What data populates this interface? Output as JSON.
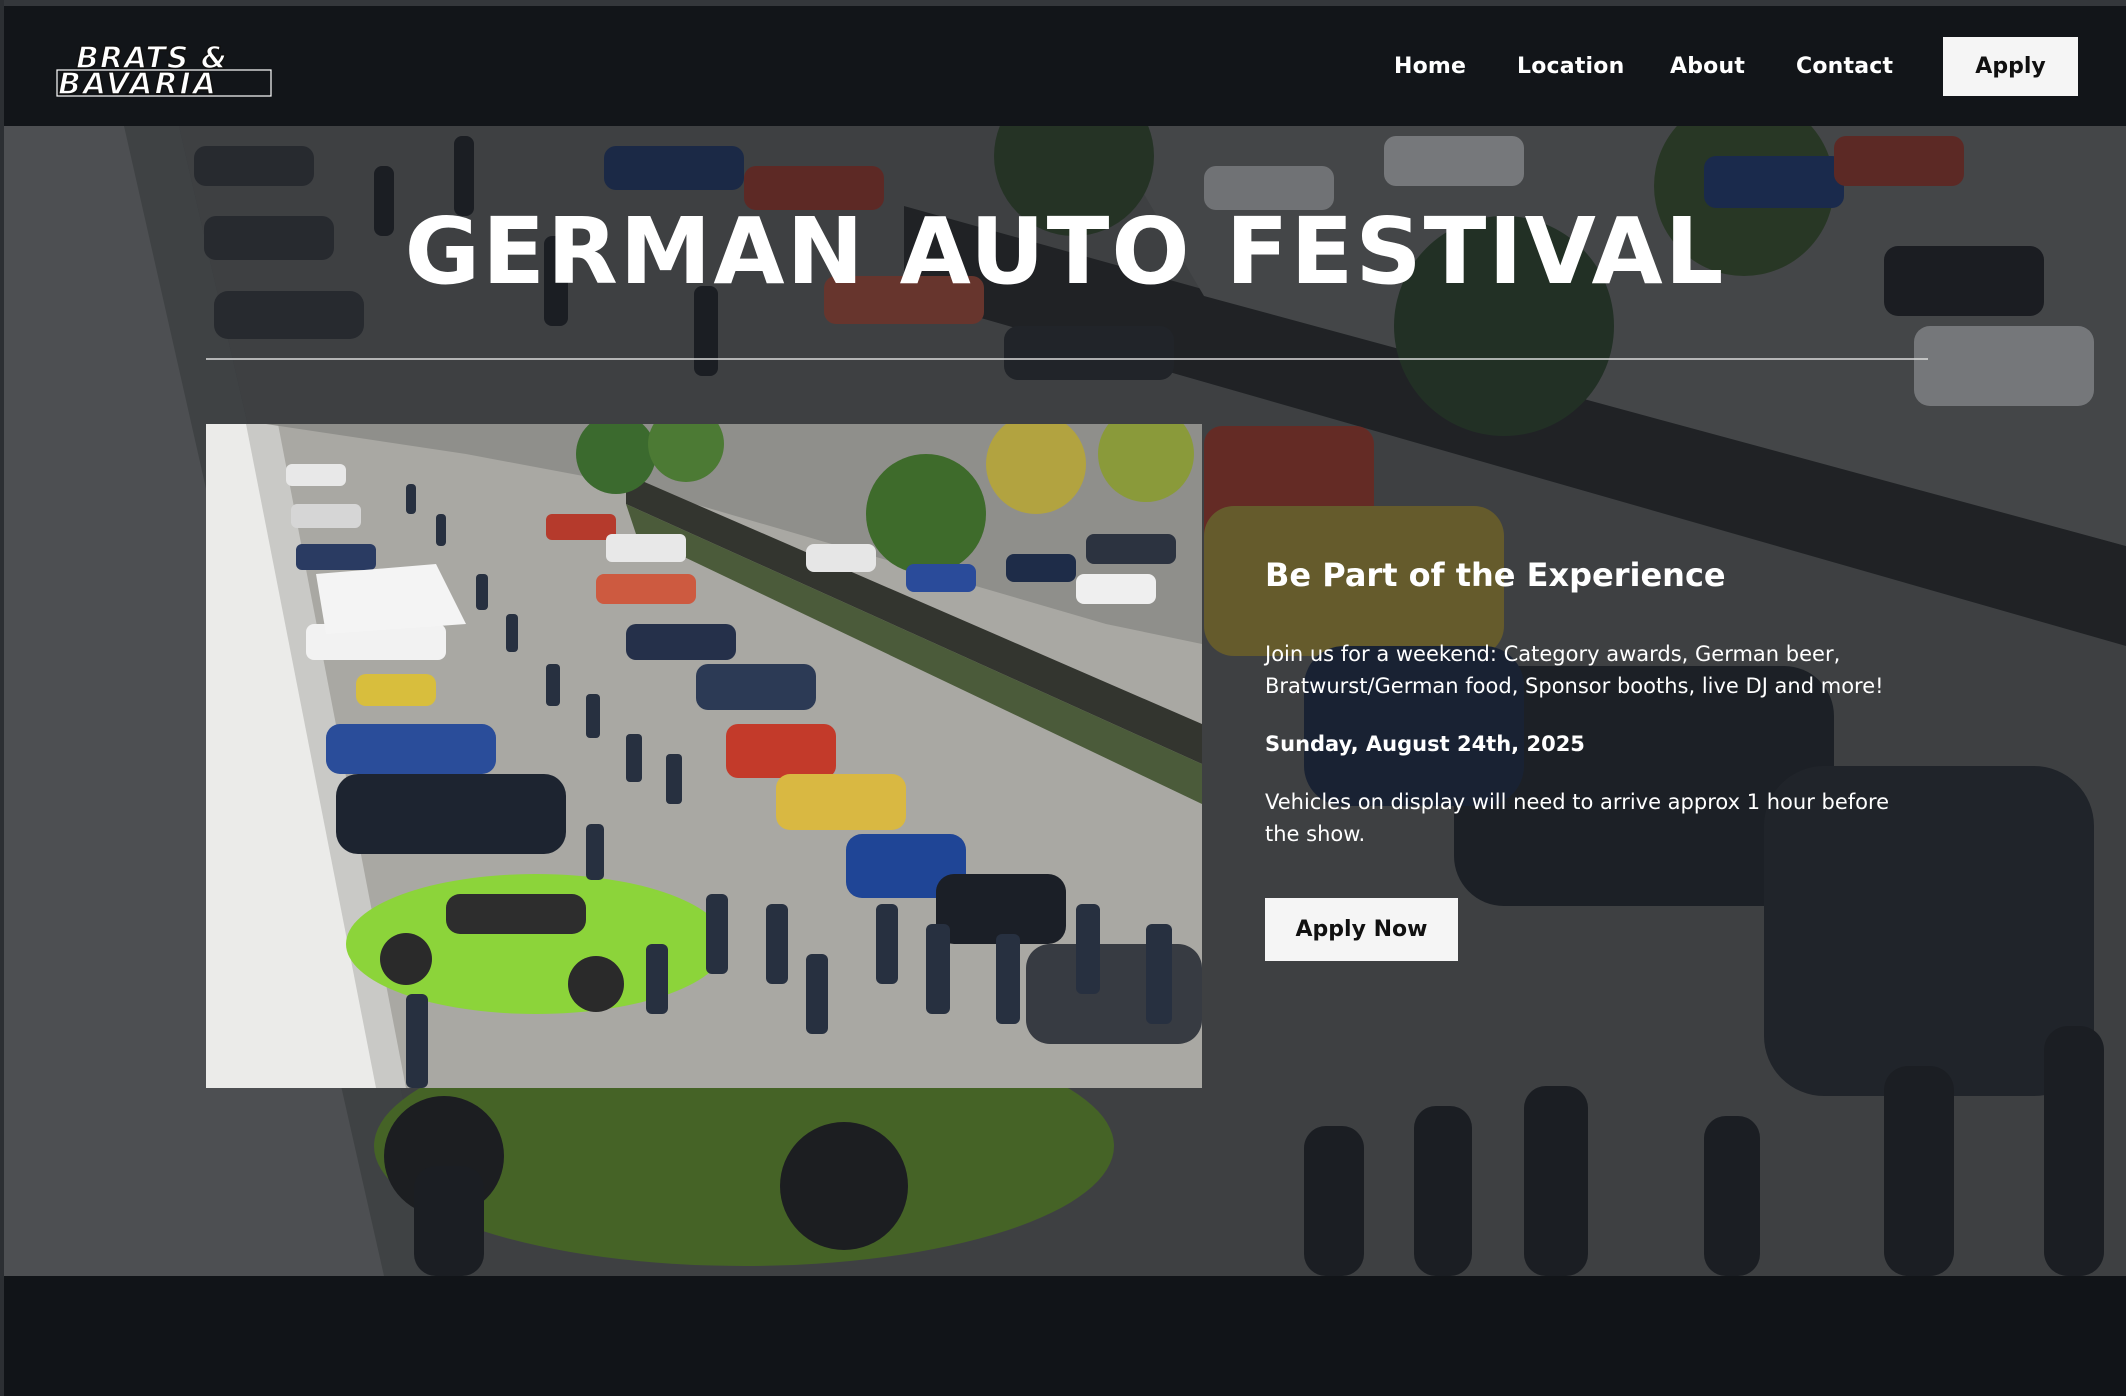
{
  "brand": {
    "logo_line1": "BRATS &",
    "logo_line2": "BAVARIA"
  },
  "nav": {
    "items": [
      {
        "label": "Home"
      },
      {
        "label": "Location"
      },
      {
        "label": "About"
      },
      {
        "label": "Contact"
      }
    ],
    "apply_label": "Apply"
  },
  "hero": {
    "title": "GERMAN AUTO FESTIVAL"
  },
  "info": {
    "heading": "Be Part of the Experience",
    "description": "Join us for a weekend: Category awards, German beer, Bratwurst/German food, Sponsor booths, live DJ and more!",
    "date": "Sunday, August 24th, 2025",
    "note": "Vehicles on display will need to arrive approx 1 hour before the show.",
    "cta_label": "Apply Now"
  },
  "colors": {
    "nav_bg": "#121519",
    "page_bg": "#111418",
    "button_bg": "#f5f5f5",
    "text": "#ffffff"
  }
}
